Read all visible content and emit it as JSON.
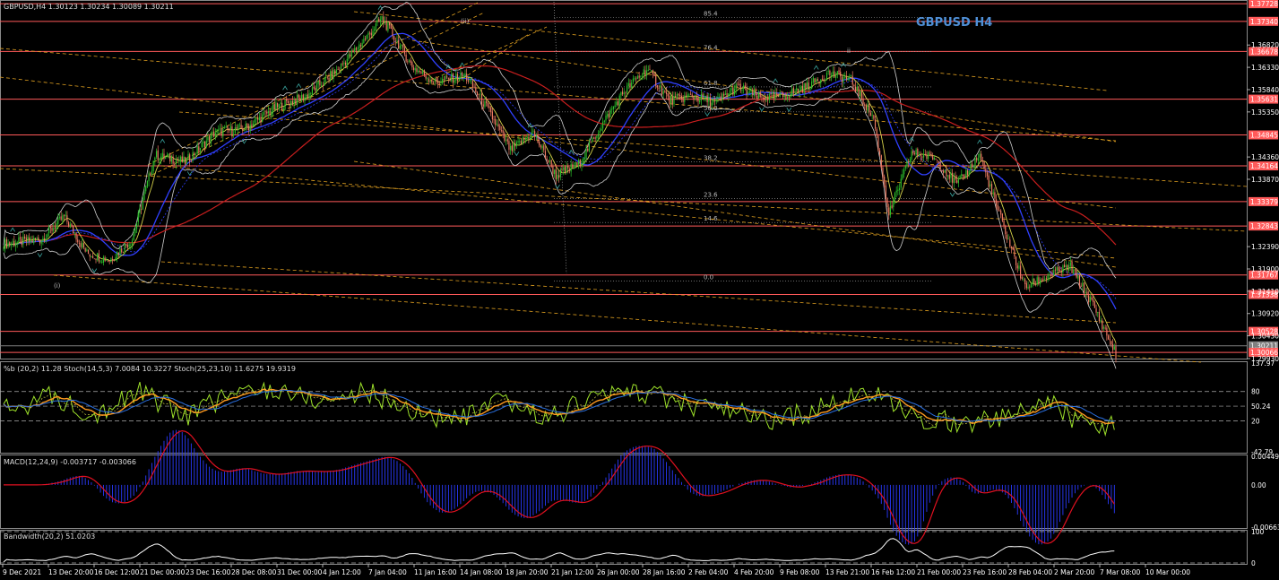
{
  "chart_data": {
    "type": "candlestick",
    "symbol_header": "GBPUSD,H4  1.30123 1.30234 1.30089 1.30211",
    "title": "GBPUSD H4",
    "y_ticks": [
      "1.36820",
      "1.36330",
      "1.35840",
      "1.35350",
      "1.34360",
      "1.33870",
      "1.32390",
      "1.31900",
      "1.31410",
      "1.30920",
      "1.30430",
      "1.29930"
    ],
    "ylim": [
      1.2993,
      1.3777
    ],
    "red_levels": [
      {
        "label": "1.37728",
        "value": 1.37728,
        "color": "#ff5a5a"
      },
      {
        "label": "1.37340",
        "value": 1.3734,
        "color": "#ff5a5a"
      },
      {
        "label": "1.36678",
        "value": 1.36678,
        "color": "#ff5a5a"
      },
      {
        "label": "1.35631",
        "value": 1.35631,
        "color": "#ff5a5a"
      },
      {
        "label": "1.34845",
        "value": 1.34845,
        "color": "#ff5a5a"
      },
      {
        "label": "1.34164",
        "value": 1.34164,
        "color": "#ff5a5a"
      },
      {
        "label": "1.33379",
        "value": 1.33379,
        "color": "#ff5a5a"
      },
      {
        "label": "1.32843",
        "value": 1.32843,
        "color": "#ff5a5a"
      },
      {
        "label": "1.31767",
        "value": 1.31767,
        "color": "#ff5a5a"
      },
      {
        "label": "1.31338",
        "value": 1.31338,
        "color": "#ff5a5a"
      },
      {
        "label": "1.30528",
        "value": 1.30528,
        "color": "#ff5a5a"
      },
      {
        "label": "1.30211",
        "value": 1.30211,
        "color": "#808080"
      },
      {
        "label": "1.30066",
        "value": 1.30066,
        "color": "#ff5a5a"
      }
    ],
    "fib_labels": [
      "85.4",
      "76.4",
      "61.8",
      "50.0",
      "38.2",
      "23.6",
      "14.6",
      "0.0"
    ],
    "wave_labels": [
      "(i)",
      "(ii)",
      "ii"
    ],
    "x_ticks": [
      "9 Dec 2021",
      "13 Dec 20:00",
      "16 Dec 12:00",
      "21 Dec 00:00",
      "23 Dec 16:00",
      "28 Dec 08:00",
      "31 Dec 00:00",
      "4 Jan 12:00",
      "7 Jan 04:00",
      "11 Jan 16:00",
      "14 Jan 08:00",
      "18 Jan 20:00",
      "21 Jan 12:00",
      "26 Jan 00:00",
      "28 Jan 16:00",
      "2 Feb 04:00",
      "4 Feb 20:00",
      "9 Feb 08:00",
      "13 Feb 21:00",
      "16 Feb 12:00",
      "21 Feb 00:00",
      "23 Feb 16:00",
      "28 Feb 04:00",
      "2 Mar 20:00",
      "7 Mar 08:00",
      "10 Mar 00:00"
    ],
    "anchor_closes": [
      [
        0,
        1.3245
      ],
      [
        25,
        1.3255
      ],
      [
        40,
        1.3305
      ],
      [
        55,
        1.3225
      ],
      [
        70,
        1.321
      ],
      [
        85,
        1.3255
      ],
      [
        100,
        1.344
      ],
      [
        120,
        1.3425
      ],
      [
        140,
        1.349
      ],
      [
        160,
        1.35
      ],
      [
        180,
        1.3545
      ],
      [
        200,
        1.357
      ],
      [
        220,
        1.3625
      ],
      [
        240,
        1.37
      ],
      [
        250,
        1.374
      ],
      [
        258,
        1.37
      ],
      [
        270,
        1.3635
      ],
      [
        285,
        1.36
      ],
      [
        305,
        1.3615
      ],
      [
        320,
        1.354
      ],
      [
        335,
        1.345
      ],
      [
        350,
        1.349
      ],
      [
        365,
        1.3395
      ],
      [
        380,
        1.342
      ],
      [
        395,
        1.3505
      ],
      [
        410,
        1.358
      ],
      [
        425,
        1.363
      ],
      [
        440,
        1.356
      ],
      [
        455,
        1.357
      ],
      [
        470,
        1.3555
      ],
      [
        485,
        1.359
      ],
      [
        500,
        1.3565
      ],
      [
        515,
        1.357
      ],
      [
        530,
        1.359
      ],
      [
        545,
        1.362
      ],
      [
        560,
        1.3605
      ],
      [
        575,
        1.352
      ],
      [
        585,
        1.331
      ],
      [
        600,
        1.3445
      ],
      [
        615,
        1.3435
      ],
      [
        630,
        1.3375
      ],
      [
        645,
        1.344
      ],
      [
        660,
        1.329
      ],
      [
        675,
        1.315
      ],
      [
        690,
        1.3175
      ],
      [
        705,
        1.3195
      ],
      [
        720,
        1.311
      ],
      [
        735,
        1.3003
      ]
    ],
    "bottom_tick_labels": {
      "stoch": [
        "137.97",
        "80",
        "50.24",
        "20",
        "-42.79"
      ],
      "macd": [
        "0.004491",
        "0.00",
        "-0.006636"
      ],
      "bandwidth": [
        "100",
        "0"
      ]
    },
    "stoch_values": [
      [
        0,
        40
      ],
      [
        30,
        70
      ],
      [
        60,
        35
      ],
      [
        90,
        80
      ],
      [
        120,
        30
      ],
      [
        150,
        75
      ],
      [
        180,
        85
      ],
      [
        210,
        60
      ],
      [
        240,
        80
      ],
      [
        270,
        40
      ],
      [
        300,
        20
      ],
      [
        330,
        60
      ],
      [
        360,
        25
      ],
      [
        390,
        70
      ],
      [
        420,
        80
      ],
      [
        450,
        55
      ],
      [
        480,
        40
      ],
      [
        510,
        20
      ],
      [
        540,
        45
      ],
      [
        570,
        80
      ],
      [
        600,
        30
      ],
      [
        630,
        15
      ],
      [
        660,
        25
      ],
      [
        690,
        60
      ],
      [
        710,
        20
      ],
      [
        735,
        10
      ]
    ]
  },
  "panels": {
    "stoch_header": "%b (20,2) 11.28  Stoch(14,5,3) 7.0084 10.3227  Stoch(25,23,10) 11.6275 19.9319",
    "macd_header": "MACD(12,24,9) -0.003717 -0.003066",
    "bandwidth_header": "Bandwidth(20,2) 51.0203"
  },
  "colors": {
    "bull": "#2cc12c",
    "bear": "#ef7c64",
    "ma_red": "#c81e1e",
    "ma_blue": "#3040ff",
    "ma_yellow": "#d6d24a",
    "bb": "#cfcfcf",
    "fib": "#e0a020",
    "level": "#ff5a5a",
    "stoch_green": "#9ee22a",
    "stoch_orange": "#ff9a20",
    "stoch_blue": "#2a6fe0"
  }
}
